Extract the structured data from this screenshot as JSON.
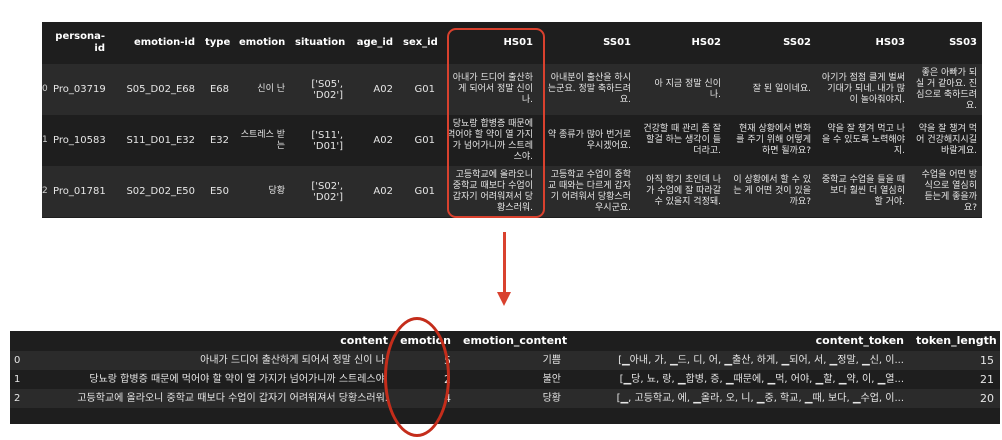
{
  "colors": {
    "highlight": "#d9412e",
    "table_bg": "#1e1e1e",
    "row_alt": "#2b2b2b"
  },
  "top_table": {
    "columns": [
      "",
      "persona-id",
      "emotion-id",
      "type",
      "emotion",
      "situation",
      "age_id",
      "sex_id",
      "HS01",
      "SS01",
      "HS02",
      "SS02",
      "HS03",
      "SS03"
    ],
    "rows": [
      {
        "index": "0",
        "persona_id": "Pro_03719",
        "emotion_id": "S05_D02_E68",
        "type": "E68",
        "emotion": "신이 난",
        "situation": "['S05', 'D02']",
        "age_id": "A02",
        "sex_id": "G01",
        "HS01": "아내가 드디어 출산하게 되어서 정말 신이 나.",
        "SS01": "아내분이 출산을 하시는군요. 정말 축하드려요.",
        "HS02": "아 지금 정말 신이 나.",
        "SS02": "잘 된 일이네요.",
        "HS03": "아기가 점점 클게 벌써 기대가 되네. 내가 많이 놀아줘야지.",
        "SS03": "좋은 아빠가 되실 거 같아요. 진심으로 축하드려요."
      },
      {
        "index": "1",
        "persona_id": "Pro_10583",
        "emotion_id": "S11_D01_E32",
        "type": "E32",
        "emotion": "스트레스 받는",
        "situation": "['S11', 'D01']",
        "age_id": "A02",
        "sex_id": "G01",
        "HS01": "당뇨랑 합병증 때문에 먹어야 할 약이 열 가지가 넘어가니까 스트레스야.",
        "SS01": "약 종류가 많아 번거로우시겠어요.",
        "HS02": "건강할 때 관리 좀 잘할걸 하는 생각이 들더라고.",
        "SS02": "현재 상황에서 변화를 주기 위해 어떻게 하면 될까요?",
        "HS03": "약을 잘 챙겨 먹고 나을 수 있도록 노력해야지.",
        "SS03": "약을 잘 챙겨 먹어 건강해지시길 바랄게요."
      },
      {
        "index": "2",
        "persona_id": "Pro_01781",
        "emotion_id": "S02_D02_E50",
        "type": "E50",
        "emotion": "당황",
        "situation": "['S02', 'D02']",
        "age_id": "A02",
        "sex_id": "G01",
        "HS01": "고등학교에 올라오니 중학교 때보다 수업이 갑자기 어려워져서 당황스러워.",
        "SS01": "고등학교 수업이 중학교 때와는 다르게 갑자기 어려워서 당황스러우시군요.",
        "HS02": "아직 학기 초인데 나가 수업에 잘 따라갈 수 있을지 걱정돼.",
        "SS02": "이 상황에서 할 수 있는 게 어떤 것이 있을까요?",
        "HS03": "중학교 수업을 들을 때보다 훨씬 더 열심히 할 거야.",
        "SS03": "수업을 어떤 방식으로 열심히 듣는게 좋을까요?"
      }
    ]
  },
  "bottom_table": {
    "columns": [
      "",
      "content",
      "emotion",
      "emotion_content",
      "content_token",
      "token_length"
    ],
    "rows": [
      {
        "index": "0",
        "content": "아내가 드디어 출산하게 되어서 정말 신이 나.",
        "emotion": "5",
        "emotion_content": "기쁨",
        "content_token": "[▁아내, 가, ▁드, 디, 어, ▁출산, 하게, ▁되어, 서, ▁정말, ▁신, 이...",
        "token_length": "15"
      },
      {
        "index": "1",
        "content": "당뇨랑 합병증 때문에 먹어야 할 약이 열 가지가 넘어가니까 스트레스야.",
        "emotion": "2",
        "emotion_content": "불안",
        "content_token": "[▁당, 뇨, 랑, ▁합병, 증, ▁때문에, ▁먹, 어야, ▁할, ▁약, 이, ▁열...",
        "token_length": "21"
      },
      {
        "index": "2",
        "content": "고등학교에 올라오니 중학교 때보다 수업이 갑자기 어려워져서 당황스러워.",
        "emotion": "4",
        "emotion_content": "당황",
        "content_token": "[▁, 고등학교, 에, ▁올라, 오, 니, ▁중, 학교, ▁때, 보다, ▁수업, 이...",
        "token_length": "20"
      }
    ]
  }
}
